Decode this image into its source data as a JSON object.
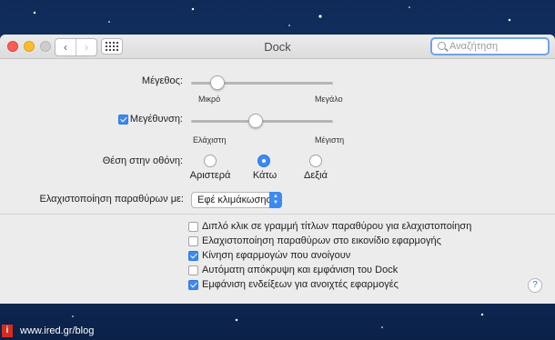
{
  "window": {
    "title": "Dock",
    "search_placeholder": "Αναζήτηση",
    "nav_back": "‹",
    "nav_forward": "›"
  },
  "size": {
    "label": "Μέγεθος:",
    "min_label": "Μικρό",
    "max_label": "Μεγάλο",
    "level": 0.15
  },
  "magnification": {
    "label": "Μεγέθυνση:",
    "checked": true,
    "min_label": "Ελάχιστη",
    "max_label": "Μέγιστη",
    "level": 0.45
  },
  "position": {
    "label": "Θέση στην οθόνη:",
    "options": [
      "Αριστερά",
      "Κάτω",
      "Δεξιά"
    ],
    "selected": "Κάτω"
  },
  "minimize": {
    "label": "Ελαχιστοποίηση παραθύρων με:",
    "value": "Εφέ κλιμάκωσης"
  },
  "options": [
    {
      "label": "Διπλό κλικ σε γραμμή τίτλων παραθύρου για ελαχιστοποίηση",
      "checked": false
    },
    {
      "label": "Ελαχιστοποίηση παραθύρων στο εικονίδιο εφαρμογής",
      "checked": false
    },
    {
      "label": "Κίνηση εφαρμογών που ανοίγουν",
      "checked": true
    },
    {
      "label": "Αυτόματη απόκρυψη και εμφάνιση του Dock",
      "checked": false
    },
    {
      "label": "Εμφάνιση ενδείξεων για ανοιχτές εφαρμογές",
      "checked": true
    }
  ],
  "help": "?",
  "footer": {
    "badge": "i",
    "text": "www.ired.gr/blog"
  },
  "colors": {
    "accent": "#3b8af4",
    "background": "#163a72"
  }
}
